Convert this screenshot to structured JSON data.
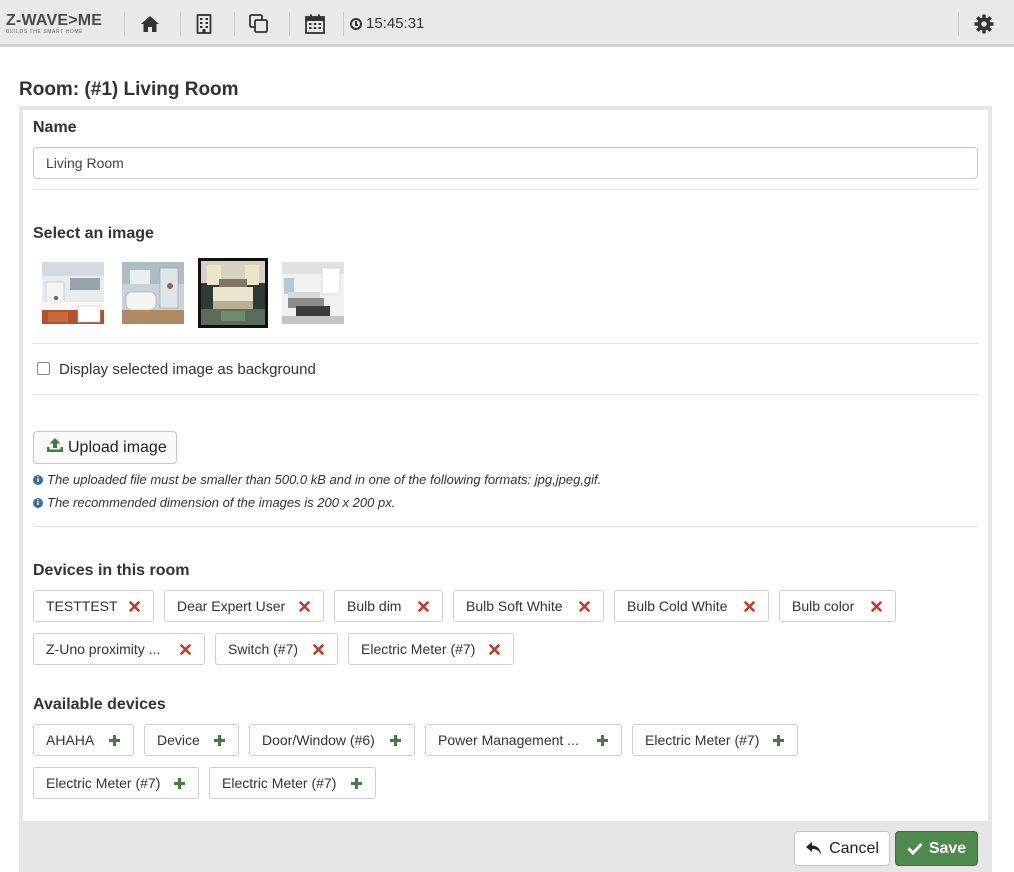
{
  "brand": {
    "logo_text": "Z-WAVE>ME",
    "tagline": "BUILDS THE SMART HOME"
  },
  "nav": {
    "icons": [
      "home-icon",
      "building-icon",
      "copy-icon",
      "calendar-icon"
    ],
    "clock": "15:45:31",
    "settings_icon": "gear-icon"
  },
  "page": {
    "title": "Room: (#1) Living Room"
  },
  "form": {
    "name_label": "Name",
    "name_value": "Living Room",
    "image_label": "Select an image",
    "images": [
      {
        "name": "kitchen",
        "selected": false
      },
      {
        "name": "bathroom",
        "selected": false
      },
      {
        "name": "bedroom",
        "selected": true
      },
      {
        "name": "living-room",
        "selected": false
      }
    ],
    "background_checkbox": {
      "label": "Display selected image as background",
      "checked": false
    },
    "upload_label": "Upload image",
    "info_1": "The uploaded file must be smaller than 500.0 kB and in one of the following formats: jpg,jpeg,gif.",
    "info_2": "The recommended dimension of the images is 200 x 200 px."
  },
  "devices_in_room": {
    "label": "Devices in this room",
    "items": [
      "TESTTEST",
      "Dear Expert User",
      "Bulb dim",
      "Bulb Soft White",
      "Bulb Cold White",
      "Bulb color",
      "Z-Uno proximity ...",
      "Switch (#7)",
      "Electric Meter (#7)"
    ]
  },
  "available_devices": {
    "label": "Available devices",
    "items": [
      "AHAHA",
      "Device",
      "Door/Window (#6)",
      "Power Management ...",
      "Electric Meter (#7)",
      "Electric Meter (#7)",
      "Electric Meter (#7)"
    ]
  },
  "actions": {
    "cancel": "Cancel",
    "save": "Save"
  },
  "colors": {
    "remove": "#c0392b",
    "add": "#3f7f3f",
    "save_bg": "#4e8a4e",
    "info": "#3f6d9e"
  }
}
